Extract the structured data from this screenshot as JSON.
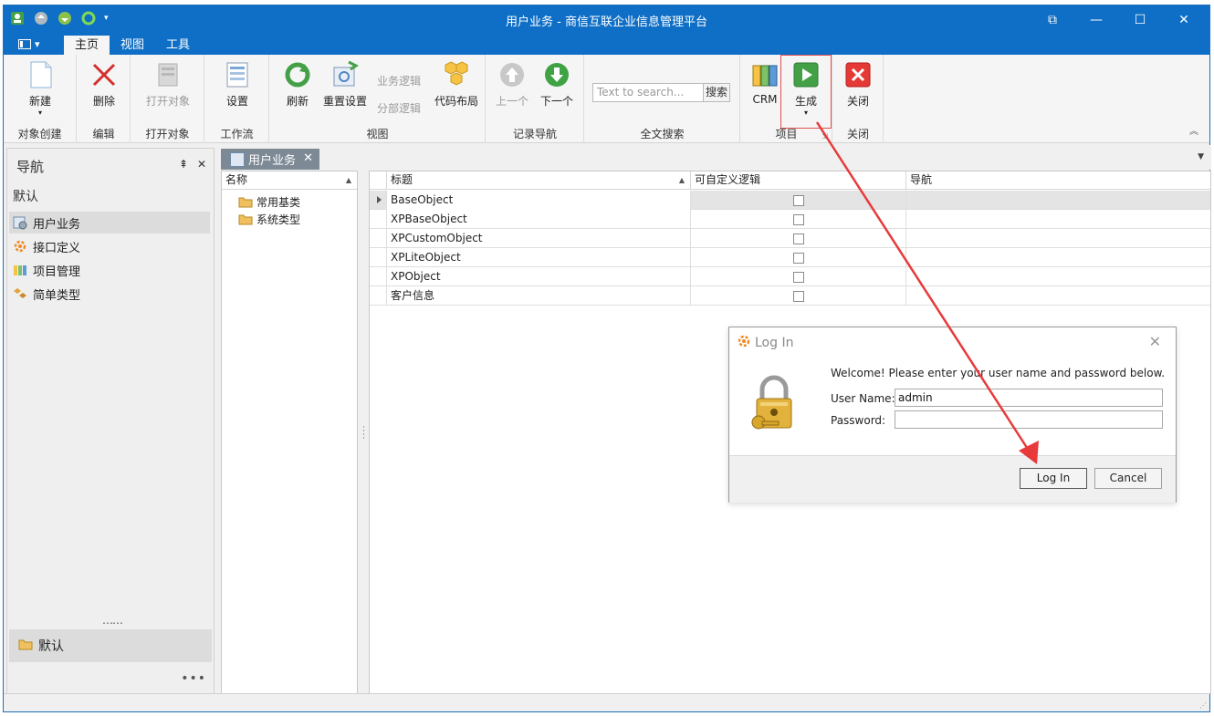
{
  "window": {
    "title": "用户业务 - 商信互联企业信息管理平台"
  },
  "ribbon": {
    "tabs": [
      {
        "label": "主页",
        "active": true
      },
      {
        "label": "视图",
        "active": false
      },
      {
        "label": "工具",
        "active": false
      }
    ],
    "groups": {
      "create": {
        "name": "对象创建",
        "new_label": "新建"
      },
      "edit": {
        "name": "编辑",
        "delete_label": "删除"
      },
      "open": {
        "name": "打开对象",
        "open_label": "打开对象"
      },
      "workflow": {
        "name": "工作流",
        "settings_label": "设置"
      },
      "view": {
        "name": "视图",
        "refresh_label": "刷新",
        "reset_label": "重置设置",
        "business_logic_label": "业务逻辑",
        "partial_logic_label": "分部逻辑",
        "code_layout_label": "代码布局"
      },
      "nav": {
        "name": "记录导航",
        "prev_label": "上一个",
        "next_label": "下一个"
      },
      "search": {
        "name": "全文搜索",
        "placeholder": "Text to search...",
        "button_label": "搜索"
      },
      "project": {
        "name": "项目",
        "crm_label": "CRM",
        "generate_label": "生成"
      },
      "close": {
        "name": "关闭",
        "close_label": "关闭"
      }
    }
  },
  "nav_pane": {
    "header": "导航",
    "group_label": "默认",
    "items": [
      {
        "label": "用户业务",
        "selected": true
      },
      {
        "label": "接口定义",
        "selected": false
      },
      {
        "label": "项目管理",
        "selected": false
      },
      {
        "label": "简单类型",
        "selected": false
      }
    ],
    "bottom_group": "默认"
  },
  "document": {
    "tab_label": "用户业务"
  },
  "tree": {
    "column_header": "名称",
    "items": [
      "常用基类",
      "系统类型"
    ]
  },
  "grid": {
    "columns": [
      "标题",
      "可自定义逻辑",
      "导航"
    ],
    "rows": [
      {
        "title": "BaseObject",
        "custom_logic": false,
        "nav": "",
        "selected": true
      },
      {
        "title": "XPBaseObject",
        "custom_logic": false,
        "nav": "",
        "selected": false
      },
      {
        "title": "XPCustomObject",
        "custom_logic": false,
        "nav": "",
        "selected": false
      },
      {
        "title": "XPLiteObject",
        "custom_logic": false,
        "nav": "",
        "selected": false
      },
      {
        "title": "XPObject",
        "custom_logic": false,
        "nav": "",
        "selected": false
      },
      {
        "title": "客户信息",
        "custom_logic": false,
        "nav": "",
        "selected": false
      }
    ]
  },
  "login_dialog": {
    "title": "Log In",
    "welcome": "Welcome! Please enter your user name and password below.",
    "username_label": "User Name:",
    "username_value": "admin",
    "password_label": "Password:",
    "password_value": "",
    "login_button": "Log In",
    "cancel_button": "Cancel"
  },
  "colors": {
    "titlebar": "#0f6fc6",
    "annotation": "#e83a3a",
    "doc_tab": "#7d8a96"
  }
}
